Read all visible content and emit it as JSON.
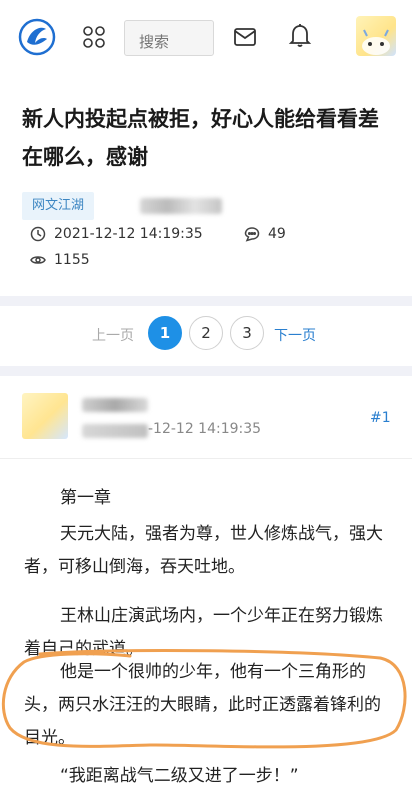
{
  "header": {
    "search_placeholder": "搜索"
  },
  "post": {
    "title": "新人内投起点被拒，好心人能给看看差在哪么，感谢",
    "tag": "网文江湖",
    "datetime": "2021-12-12 14:19:35",
    "comments": "49",
    "views": "1155"
  },
  "pagination": {
    "prev": "上一页",
    "pages": [
      "1",
      "2",
      "3"
    ],
    "current": "1",
    "next": "下一页"
  },
  "reply": {
    "time_visible": "-12-12 14:19:35",
    "floor": "#1",
    "paragraphs": [
      "第一章",
      "天元大陆，强者为尊，世人修炼战气，强大者，可移山倒海，吞天吐地。",
      "王林山庄演武场内，一个少年正在努力锻炼着自己的武道。",
      "他是一个很帅的少年，他有一个三角形的头，两只水汪汪的大眼睛，此时正透露着锋利的目光。",
      "“我距离战气二级又进了一步！”"
    ]
  },
  "colors": {
    "accent": "#1e90e6",
    "link": "#2a7fcf",
    "tag_bg": "#e9f3fb",
    "highlight_circle": "#f0a050"
  }
}
